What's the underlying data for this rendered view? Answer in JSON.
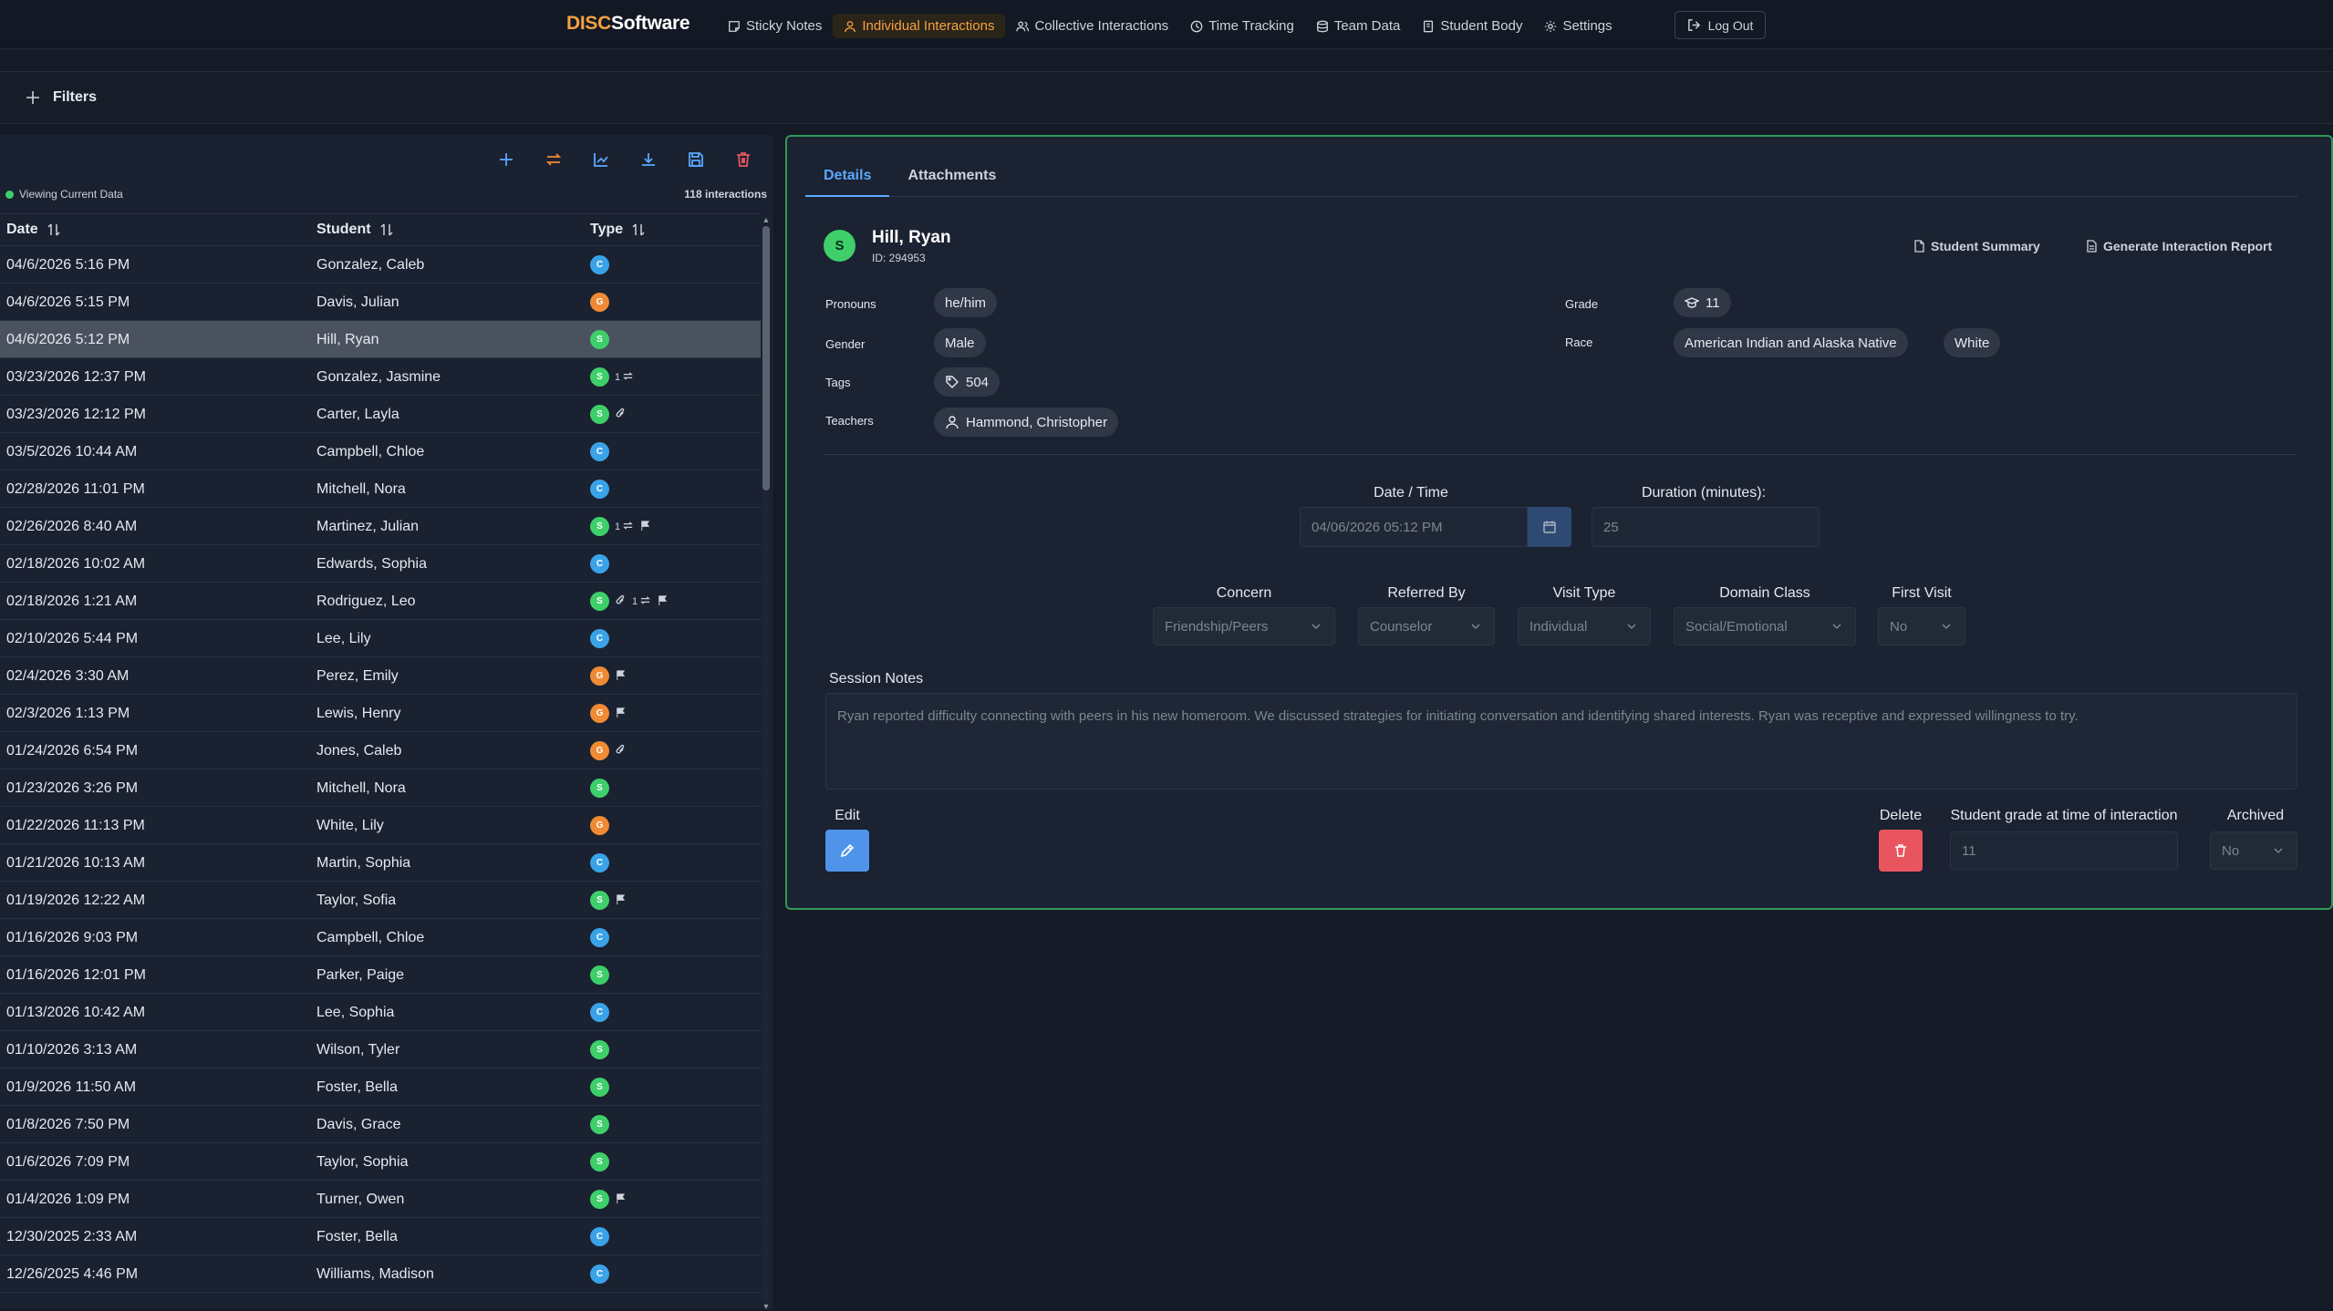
{
  "brand": {
    "prefix": "DISC",
    "suffix": "Software",
    "accent": "#f5a142"
  },
  "nav": {
    "items": [
      {
        "label": "Sticky Notes",
        "icon": "sticky-note-icon"
      },
      {
        "label": "Individual Interactions",
        "icon": "user-icon",
        "active": true
      },
      {
        "label": "Collective Interactions",
        "icon": "users-icon"
      },
      {
        "label": "Time Tracking",
        "icon": "clock-icon"
      },
      {
        "label": "Team Data",
        "icon": "database-icon"
      },
      {
        "label": "Student Body",
        "icon": "book-icon"
      },
      {
        "label": "Settings",
        "icon": "gear-icon"
      }
    ],
    "logout": "Log Out"
  },
  "filters": {
    "label": "Filters"
  },
  "list": {
    "viewing": "Viewing Current Data",
    "count": "118 interactions",
    "columns": {
      "date": "Date",
      "student": "Student",
      "type": "Type"
    },
    "rows": [
      {
        "date": "04/6/2026 5:16 PM",
        "student": "Gonzalez, Caleb",
        "type": "C"
      },
      {
        "date": "04/6/2026 5:15 PM",
        "student": "Davis, Julian",
        "type": "G"
      },
      {
        "date": "04/6/2026 5:12 PM",
        "student": "Hill, Ryan",
        "type": "S",
        "selected": true
      },
      {
        "date": "03/23/2026 12:37 PM",
        "student": "Gonzalez, Jasmine",
        "type": "S",
        "collective": "1"
      },
      {
        "date": "03/23/2026 12:12 PM",
        "student": "Carter, Layla",
        "type": "S",
        "attachment": true
      },
      {
        "date": "03/5/2026 10:44 AM",
        "student": "Campbell, Chloe",
        "type": "C"
      },
      {
        "date": "02/28/2026 11:01 PM",
        "student": "Mitchell, Nora",
        "type": "C"
      },
      {
        "date": "02/26/2026 8:40 AM",
        "student": "Martinez, Julian",
        "type": "S",
        "collective": "1",
        "flag": true
      },
      {
        "date": "02/18/2026 10:02 AM",
        "student": "Edwards, Sophia",
        "type": "C"
      },
      {
        "date": "02/18/2026 1:21 AM",
        "student": "Rodriguez, Leo",
        "type": "S",
        "attachment": true,
        "collective": "1",
        "flag": true
      },
      {
        "date": "02/10/2026 5:44 PM",
        "student": "Lee, Lily",
        "type": "C"
      },
      {
        "date": "02/4/2026 3:30 AM",
        "student": "Perez, Emily",
        "type": "G",
        "flag": true
      },
      {
        "date": "02/3/2026 1:13 PM",
        "student": "Lewis, Henry",
        "type": "G",
        "flag": true
      },
      {
        "date": "01/24/2026 6:54 PM",
        "student": "Jones, Caleb",
        "type": "G",
        "attachment": true
      },
      {
        "date": "01/23/2026 3:26 PM",
        "student": "Mitchell, Nora",
        "type": "S"
      },
      {
        "date": "01/22/2026 11:13 PM",
        "student": "White, Lily",
        "type": "G"
      },
      {
        "date": "01/21/2026 10:13 AM",
        "student": "Martin, Sophia",
        "type": "C"
      },
      {
        "date": "01/19/2026 12:22 AM",
        "student": "Taylor, Sofia",
        "type": "S",
        "flag": true
      },
      {
        "date": "01/16/2026 9:03 PM",
        "student": "Campbell, Chloe",
        "type": "C"
      },
      {
        "date": "01/16/2026 12:01 PM",
        "student": "Parker, Paige",
        "type": "S"
      },
      {
        "date": "01/13/2026 10:42 AM",
        "student": "Lee, Sophia",
        "type": "C"
      },
      {
        "date": "01/10/2026 3:13 AM",
        "student": "Wilson, Tyler",
        "type": "S"
      },
      {
        "date": "01/9/2026 11:50 AM",
        "student": "Foster, Bella",
        "type": "S"
      },
      {
        "date": "01/8/2026 7:50 PM",
        "student": "Davis, Grace",
        "type": "S"
      },
      {
        "date": "01/6/2026 7:09 PM",
        "student": "Taylor, Sophia",
        "type": "S"
      },
      {
        "date": "01/4/2026 1:09 PM",
        "student": "Turner, Owen",
        "type": "S",
        "flag": true
      },
      {
        "date": "12/30/2025 2:33 AM",
        "student": "Foster, Bella",
        "type": "C"
      },
      {
        "date": "12/26/2025 4:46 PM",
        "student": "Williams, Madison",
        "type": "C"
      }
    ]
  },
  "detail": {
    "tabs": [
      "Details",
      "Attachments"
    ],
    "avatar_letter": "S",
    "student_name": "Hill, Ryan",
    "student_id": "ID: 294953",
    "student_summary": "Student Summary",
    "generate_report": "Generate Interaction Report",
    "labels": {
      "pronouns": "Pronouns",
      "gender": "Gender",
      "tags": "Tags",
      "teachers": "Teachers",
      "grade": "Grade",
      "race": "Race"
    },
    "pronouns": "he/him",
    "gender": "Male",
    "tag": "504",
    "teacher": "Hammond, Christopher",
    "grade": "11",
    "race": [
      "American Indian and Alaska Native",
      "White"
    ],
    "datetime_label": "Date / Time",
    "datetime_value": "04/06/2026 05:12 PM",
    "duration_label": "Duration (minutes):",
    "duration_value": "25",
    "fields": [
      {
        "label": "Concern",
        "value": "Friendship/Peers"
      },
      {
        "label": "Referred By",
        "value": "Counselor"
      },
      {
        "label": "Visit Type",
        "value": "Individual"
      },
      {
        "label": "Domain Class",
        "value": "Social/Emotional"
      },
      {
        "label": "First Visit",
        "value": "No"
      }
    ],
    "notes_label": "Session Notes",
    "notes": "Ryan reported difficulty connecting with peers in his new homeroom. We discussed strategies for initiating conversation and identifying shared interests. Ryan was receptive and expressed willingness to try.",
    "edit_label": "Edit",
    "delete_label": "Delete",
    "grade_at_time_label": "Student grade at time of interaction",
    "grade_at_time_value": "11",
    "archived_label": "Archived",
    "archived_value": "No"
  },
  "colors": {
    "accent": "#f5a142",
    "active_tab": "#5aa8ff",
    "selected_border": "#2f9a5a",
    "type_S": "#3ecf6b",
    "type_C": "#3aa3e8",
    "type_G": "#f08a34",
    "delete": "#e9555f",
    "edit": "#4f94ea"
  }
}
